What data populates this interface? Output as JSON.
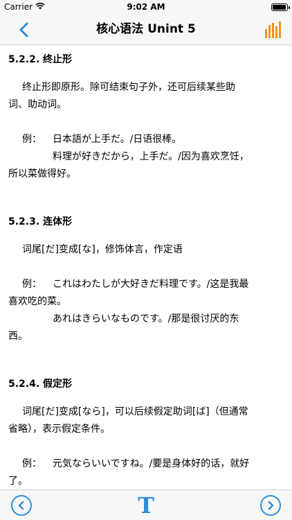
{
  "status_bar": {
    "carrier": "Carrier",
    "time": "9:02 AM",
    "battery_level": 0.95
  },
  "nav": {
    "title": "核心语法 Unint 5",
    "back_icon": "chevron-left-icon",
    "right_icon": "bar-chart-icon",
    "accent_color": "#2b8fd9",
    "right_icon_color": "#f5901e"
  },
  "sections": [
    {
      "heading": "5.2.2. 终止形",
      "body": [
        "终止形即原形。除可结束句子外，还可后续某些助",
        "词、助动词。"
      ],
      "example_label": "例：",
      "example_lines": [
        "日本語が上手だ。/日语很棒。",
        "料理が好きだから，上手だ。/因为喜欢烹饪，"
      ],
      "example_wrap": "所以菜做得好。"
    },
    {
      "heading": "5.2.3. 连体形",
      "body": [
        "词尾[だ]变成[な]，修饰体言，作定语"
      ],
      "example_label": "例：",
      "example_lines": [
        "これはわたしが大好きだ料理です。/这是我最"
      ],
      "example_wrap_1": "喜欢吃的菜。",
      "example_lines_2": [
        "あれはきらいなものです。/那是很讨厌的东"
      ],
      "example_wrap_2": "西。"
    },
    {
      "heading": "5.2.4. 假定形",
      "body": [
        "词尾[だ]变成[なら]，可以后续假定助词[ば]（但通常",
        "省略），表示假定条件。"
      ],
      "example_label": "例：",
      "example_lines": [
        "元気ならいいですね。/要是身体好的话，就好"
      ],
      "example_wrap": "了。"
    }
  ],
  "toolbar": {
    "prev_icon": "chevron-left-circle-icon",
    "font_label": "T",
    "next_icon": "chevron-right-circle-icon"
  }
}
